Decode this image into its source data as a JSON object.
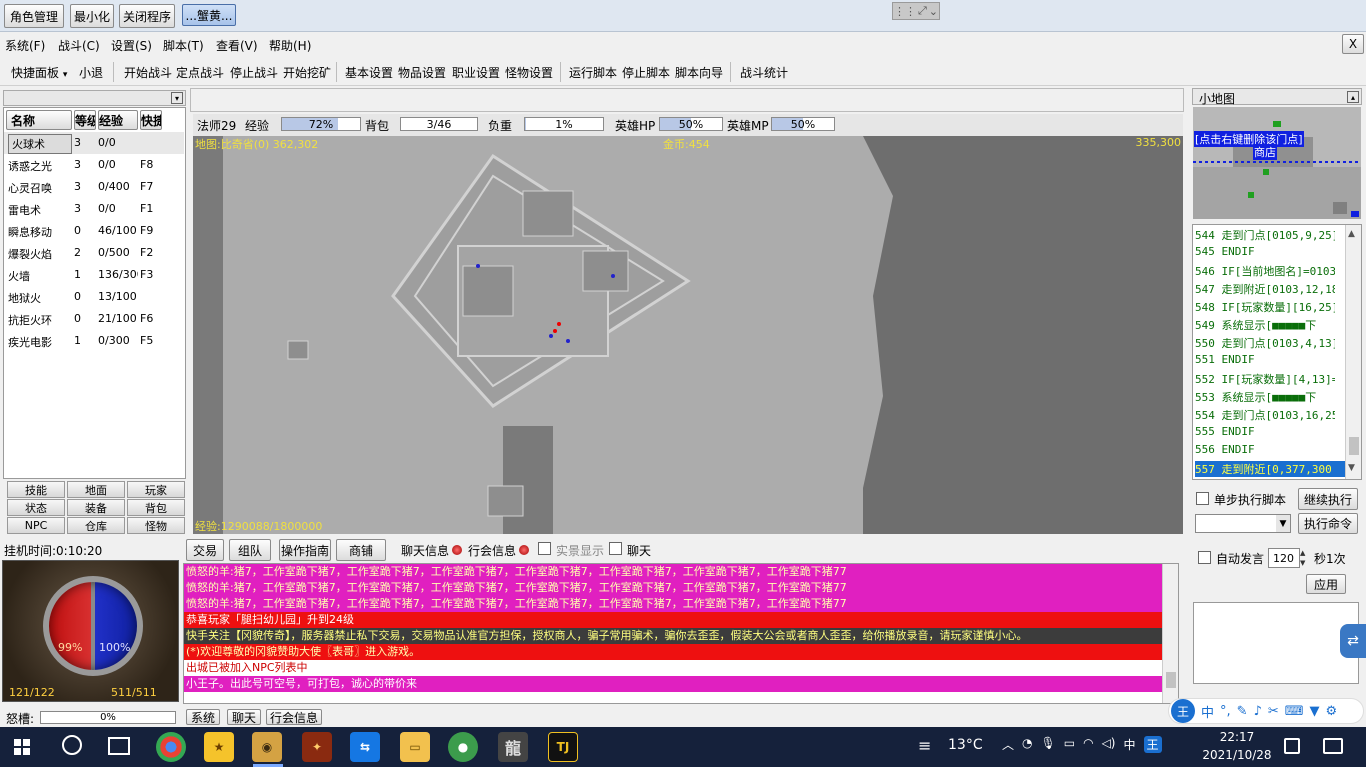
{
  "topbar": {
    "buttons": [
      "角色管理",
      "最小化",
      "关闭程序",
      "...蟹黄..."
    ]
  },
  "menu": {
    "items": [
      "系统(F)",
      "战斗(C)",
      "设置(S)",
      "脚本(T)",
      "查看(V)",
      "帮助(H)"
    ],
    "close": "X"
  },
  "toolbar": {
    "quick_panel": "快捷面板",
    "small_exit": "小退",
    "battle": [
      "开始战斗",
      "定点战斗",
      "停止战斗",
      "开始挖矿"
    ],
    "settings": [
      "基本设置",
      "物品设置",
      "职业设置",
      "怪物设置"
    ],
    "script": [
      "运行脚本",
      "停止脚本",
      "脚本向导"
    ],
    "stats": "战斗统计"
  },
  "skills": {
    "headers": [
      "名称",
      "等级",
      "经验",
      "快捷"
    ],
    "rows": [
      {
        "name": "火球术",
        "level": "3",
        "exp": "0/0",
        "key": ""
      },
      {
        "name": "诱惑之光",
        "level": "3",
        "exp": "0/0",
        "key": "F8"
      },
      {
        "name": "心灵召唤",
        "level": "3",
        "exp": "0/400",
        "key": "F7"
      },
      {
        "name": "雷电术",
        "level": "3",
        "exp": "0/0",
        "key": "F1"
      },
      {
        "name": "瞬息移动",
        "level": "0",
        "exp": "46/100",
        "key": "F9"
      },
      {
        "name": "爆裂火焰",
        "level": "2",
        "exp": "0/500",
        "key": "F2"
      },
      {
        "name": "火墙",
        "level": "1",
        "exp": "136/300",
        "key": "F3"
      },
      {
        "name": "地狱火",
        "level": "0",
        "exp": "13/100",
        "key": ""
      },
      {
        "name": "抗拒火环",
        "level": "0",
        "exp": "21/100",
        "key": "F6"
      },
      {
        "name": "疾光电影",
        "level": "1",
        "exp": "0/300",
        "key": "F5"
      }
    ],
    "tabs": [
      "技能",
      "地面",
      "玩家",
      "状态",
      "装备",
      "背包",
      "NPC",
      "仓库",
      "怪物"
    ]
  },
  "status_bar": {
    "class_level": "法师29",
    "exp_label": "经验",
    "exp_value": "72%",
    "bag_label": "背包",
    "bag_value": "3/46",
    "weight_label": "负重",
    "weight_value": "1%",
    "hero_hp_label": "英雄HP",
    "hero_hp_value": "50%",
    "hero_mp_label": "英雄MP",
    "hero_mp_value": "50%",
    "exp_fill": 0.72,
    "weight_fill": 0.01,
    "hero_hp_fill": 0.5,
    "hero_mp_fill": 0.5
  },
  "map": {
    "location": "地图:比奇省(0) 362,302",
    "gold": "金币:454",
    "cursor": "335,300",
    "experience": "经验:1290088/1800000"
  },
  "hang": {
    "time": "挂机时间:0:10:20",
    "hp_pct": "99%",
    "mp_pct": "100%",
    "hp": "121/122",
    "mp": "511/511",
    "rage_label": "怒槽:",
    "rage_value": "0%"
  },
  "chat": {
    "buttons": [
      "交易",
      "组队",
      "操作指南",
      "商铺"
    ],
    "chat_info": "聊天信息",
    "guild_info": "行会信息",
    "real_display": "实景显示",
    "chat_check": "聊天",
    "lines": [
      {
        "text": "愤怒的羊:猪7，工作室跪下猪7，工作室跪下猪7，工作室跪下猪7，工作室跪下猪7，工作室跪下猪7，工作室跪下猪7，工作室跪下猪77",
        "color": "#e020c0",
        "fg": "#ffffb0"
      },
      {
        "text": "愤怒的羊:猪7，工作室跪下猪7，工作室跪下猪7，工作室跪下猪7，工作室跪下猪7，工作室跪下猪7，工作室跪下猪7，工作室跪下猪77",
        "color": "#e020c0",
        "fg": "#ffffb0"
      },
      {
        "text": "愤怒的羊:猪7，工作室跪下猪7，工作室跪下猪7，工作室跪下猪7，工作室跪下猪7，工作室跪下猪7，工作室跪下猪7，工作室跪下猪77",
        "color": "#e020c0",
        "fg": "#ffffb0"
      },
      {
        "text": "恭喜玩家「腿扫幼儿园」升到24级",
        "color": "#ee1010",
        "fg": "#ffffff"
      },
      {
        "text": "快手关注【冈貌传奇】，服务器禁止私下交易，交易物品认准官方担保，授权商人，骗子常用骗术，骗你去歪歪，假装大公会或者商人歪歪，给你播放录音，请玩家谨慎小心。",
        "color": "#3c3c3c",
        "fg": "#ffff80"
      },
      {
        "text": "(*)欢迎尊敬的冈貌赞助大使〖表哥〗进入游戏。",
        "color": "#ee1010",
        "fg": "#ffffb0"
      },
      {
        "text": "出城已被加入NPC列表中",
        "color": "#ffffff",
        "fg": "#cc0000"
      },
      {
        "text": "小王子。出此号可空号，可打包，诚心的带价来",
        "color": "#e020c0",
        "fg": "#ffffff"
      }
    ],
    "tabs": [
      "系统",
      "聊天",
      "行会信息"
    ]
  },
  "minimap": {
    "title": "小地图",
    "hint": "[点击右键删除该门点]",
    "shop": "商店"
  },
  "script": {
    "lines": [
      "544 走到门点[0105,9,25]",
      "545 ENDIF",
      "546 IF[当前地图名]=0103",
      "547 走到附近[0103,12,18]",
      "548 IF[玩家数量][16,25]=1",
      "549 系统显示[■■■■■下",
      "550 走到门点[0103,4,13]",
      "551 ENDIF",
      "552 IF[玩家数量][4,13]=1",
      "553 系统显示[■■■■■下",
      "554 走到门点[0103,16,25]",
      "555 ENDIF",
      "556 ENDIF",
      "557 走到附近[0,377,300"
    ],
    "step_exec": "单步执行脚本",
    "continue": "继续执行",
    "exec_cmd": "执行命令"
  },
  "auto_speak": {
    "label": "自动发言",
    "seconds": "120",
    "unit": "秒1次",
    "apply": "应用"
  },
  "taskbar": {
    "weather": "13°C",
    "time": "22:17",
    "date": "2021/10/28",
    "ime": "中",
    "tray_ime": "王",
    "apps": [
      "chrome",
      "app-folder",
      "app-pet",
      "app-legend",
      "teamviewer",
      "explorer",
      "maps",
      "龍",
      "TJ"
    ]
  }
}
